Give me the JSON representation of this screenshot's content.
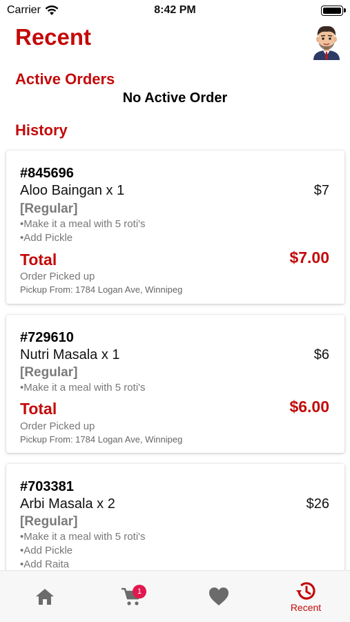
{
  "status_bar": {
    "carrier": "Carrier",
    "time": "8:42 PM"
  },
  "header": {
    "title": "Recent"
  },
  "active": {
    "title": "Active Orders",
    "empty_text": "No Active Order"
  },
  "history": {
    "title": "History",
    "orders": [
      {
        "id": "#845696",
        "item": "Aloo Baingan x 1",
        "price": "$7",
        "variant": "[Regular]",
        "addons": [
          "•Make it a meal with 5 roti's",
          "•Add Pickle"
        ],
        "total_label": "Total",
        "total": "$7.00",
        "status": "Order Picked up",
        "pickup": "Pickup From: 1784 Logan Ave, Winnipeg"
      },
      {
        "id": "#729610",
        "item": "Nutri Masala x 1",
        "price": "$6",
        "variant": "[Regular]",
        "addons": [
          "•Make it a meal with 5 roti's"
        ],
        "total_label": "Total",
        "total": "$6.00",
        "status": "Order Picked up",
        "pickup": "Pickup From: 1784 Logan Ave, Winnipeg"
      },
      {
        "id": "#703381",
        "item": "Arbi Masala x 2",
        "price": "$26",
        "variant": "[Regular]",
        "addons": [
          "•Make it a meal with 5 roti's",
          "•Add Pickle",
          "•Add Raita"
        ]
      }
    ]
  },
  "tabbar": {
    "tabs": [
      {
        "icon": "home-icon",
        "label": ""
      },
      {
        "icon": "cart-icon",
        "label": "",
        "badge": "1"
      },
      {
        "icon": "heart-icon",
        "label": ""
      },
      {
        "icon": "recent-icon",
        "label": "Recent"
      }
    ]
  },
  "colors": {
    "accent": "#c30a0a",
    "badge": "#e0184d",
    "inactive_icon": "#6b6b6b"
  }
}
